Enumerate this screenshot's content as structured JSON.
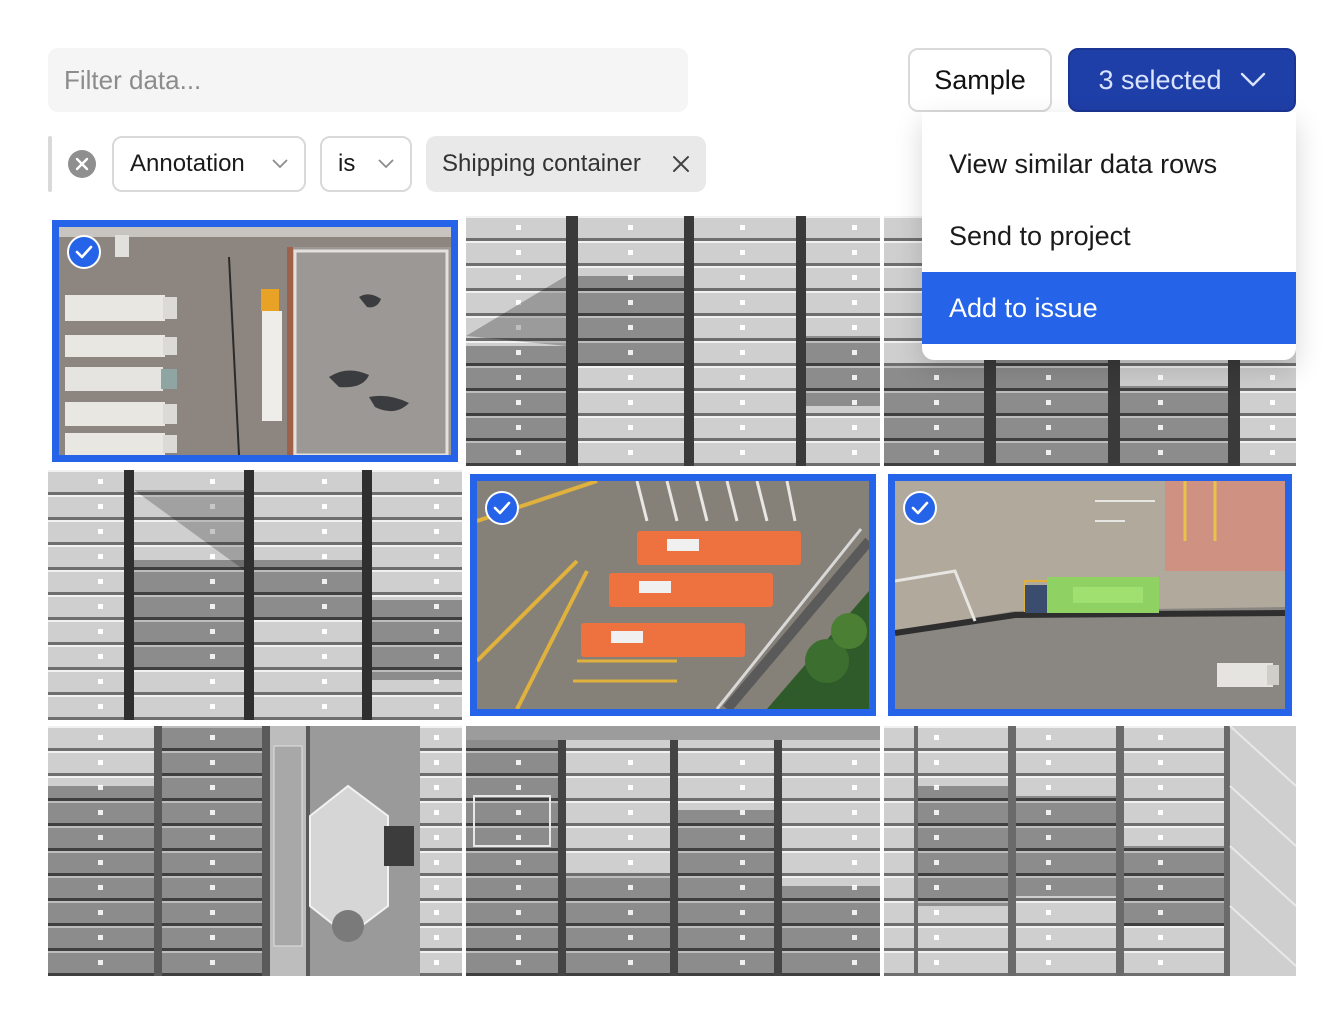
{
  "search": {
    "placeholder": "Filter data..."
  },
  "toolbar": {
    "sample_label": "Sample",
    "selected_label": "3 selected",
    "selected_count": 3
  },
  "filter": {
    "field": "Annotation",
    "operator": "is",
    "value": "Shipping container"
  },
  "menu": {
    "items": [
      {
        "label": "View similar data rows",
        "active": false
      },
      {
        "label": "Send to project",
        "active": false
      },
      {
        "label": "Add to issue",
        "active": true
      }
    ]
  },
  "grid": {
    "tiles": [
      {
        "content": "aerial-trucks-lot",
        "selected": true
      },
      {
        "content": "container-stacks-grayscale",
        "selected": false
      },
      {
        "content": "container-stacks-grayscale",
        "selected": false
      },
      {
        "content": "container-stacks-grayscale",
        "selected": false
      },
      {
        "content": "aerial-orange-buses",
        "selected": true
      },
      {
        "content": "aerial-green-truck-ramp",
        "selected": true
      },
      {
        "content": "container-ship-deck-grayscale",
        "selected": false
      },
      {
        "content": "container-stacks-grayscale",
        "selected": false
      },
      {
        "content": "container-ship-deck-grayscale",
        "selected": false
      }
    ]
  },
  "colors": {
    "accent": "#2564e8",
    "primary_button": "#1f3fa8",
    "surface": "#f5f5f5"
  }
}
